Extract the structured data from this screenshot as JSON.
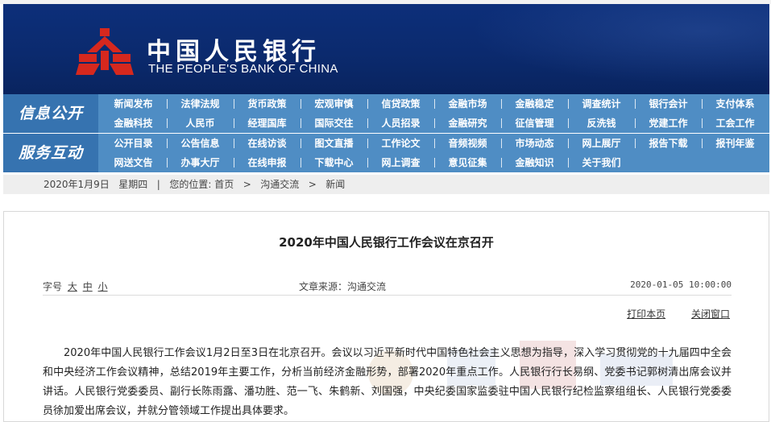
{
  "header": {
    "title_cn": "中国人民银行",
    "title_en": "THE PEOPLE'S BANK OF CHINA",
    "colors": {
      "banner": "#0b2a6e",
      "emblem": "#d6281e",
      "nav": "#4f8dc4"
    }
  },
  "nav": {
    "sections": [
      {
        "title": "信息公开",
        "rows": [
          [
            "新闻发布",
            "法律法规",
            "货币政策",
            "宏观审慎",
            "信贷政策",
            "金融市场",
            "金融稳定",
            "调查统计",
            "银行会计",
            "支付体系"
          ],
          [
            "金融科技",
            "人民币",
            "经理国库",
            "国际交往",
            "人员招录",
            "金融研究",
            "征信管理",
            "反洗钱",
            "党建工作",
            "工会工作"
          ]
        ]
      },
      {
        "title": "服务互动",
        "rows": [
          [
            "公开目录",
            "公告信息",
            "在线访谈",
            "图文直播",
            "工作论文",
            "音频视频",
            "市场动态",
            "网上展厅",
            "报告下载",
            "报刊年鉴"
          ],
          [
            "网送文告",
            "办事大厅",
            "在线申报",
            "下载中心",
            "网上调查",
            "意见征集",
            "金融知识",
            "关于我们"
          ]
        ]
      }
    ]
  },
  "breadcrumb": {
    "date": "2020年1月9日",
    "weekday": "星期四",
    "separator": "|",
    "location_label": "您的位置:",
    "items": [
      "首页",
      "沟通交流",
      "新闻"
    ],
    "arrow": ">"
  },
  "article": {
    "title": "2020年中国人民银行工作会议在京召开",
    "font_size_label": "字号",
    "font_sizes": [
      "大",
      "中",
      "小"
    ],
    "source": "文章来源：沟通交流",
    "date": "2020-01-05 10:00:00",
    "print_label": "打印本页",
    "close_label": "关闭窗口",
    "body": "2020年中国人民银行工作会议1月2日至3日在北京召开。会议以习近平新时代中国特色社会主义思想为指导，深入学习贯彻党的十九届四中全会和中央经济工作会议精神，总结2019年主要工作，分析当前经济金融形势，部署2020年重点工作。人民银行行长易纲、党委书记郭树清出席会议并讲话。人民银行党委委员、副行长陈雨露、潘功胜、范一飞、朱鹤新、刘国强，中央纪委国家监委驻中国人民银行纪检监察组组长、人民银行党委委员徐加爱出席会议，并就分管领域工作提出具体要求。"
  }
}
